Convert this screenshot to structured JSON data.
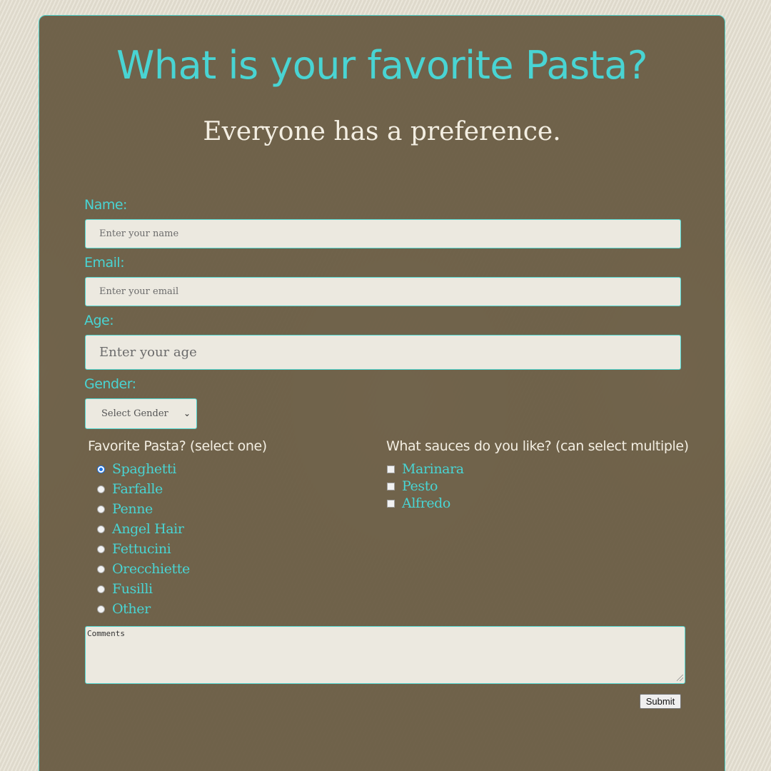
{
  "header": {
    "title": "What is your favorite Pasta?",
    "subtitle": "Everyone has a preference."
  },
  "form": {
    "name": {
      "label": "Name:",
      "placeholder": "Enter your name",
      "value": ""
    },
    "email": {
      "label": "Email:",
      "placeholder": "Enter your email",
      "value": ""
    },
    "age": {
      "label": "Age:",
      "placeholder": "Enter your age",
      "value": ""
    },
    "gender": {
      "label": "Gender:",
      "selected": "Select Gender"
    },
    "pasta": {
      "heading": "Favorite Pasta? (select one)",
      "selected": "Spaghetti",
      "options": [
        "Spaghetti",
        "Farfalle",
        "Penne",
        "Angel Hair",
        "Fettucini",
        "Orecchiette",
        "Fusilli",
        "Other"
      ]
    },
    "sauces": {
      "heading": "What sauces do you like? (can select multiple)",
      "options": [
        "Marinara",
        "Pesto",
        "Alfredo"
      ]
    },
    "comments": {
      "placeholder": "Comments",
      "value": ""
    },
    "submit_label": "Submit"
  },
  "colors": {
    "accent": "#49d4d3",
    "card": "#665840",
    "subtitle": "#f3eee2"
  }
}
